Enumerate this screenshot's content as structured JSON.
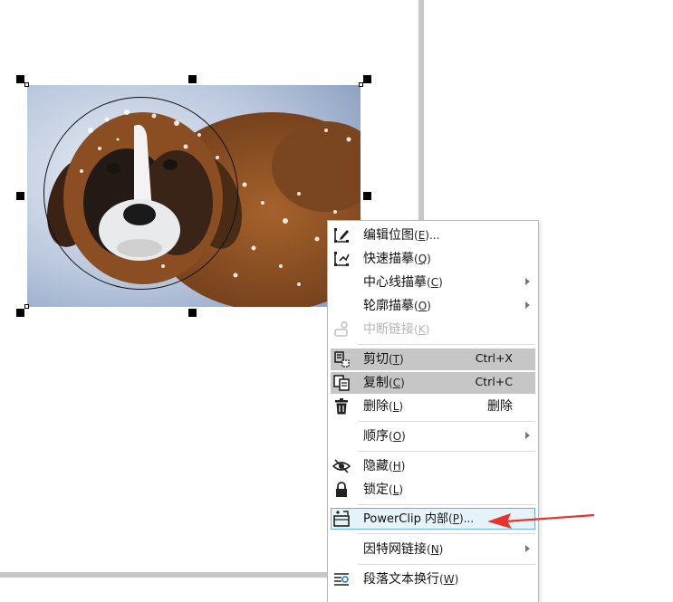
{
  "canvas": {
    "photo_subject": "saint-bernard-dog-in-snow"
  },
  "context_menu": {
    "items": [
      {
        "label": "编辑位图",
        "mnemonic": "E",
        "suffix": "...",
        "icon": "edit-bitmap-icon",
        "submenu": false,
        "shortcut": ""
      },
      {
        "label": "快速描摹",
        "mnemonic": "Q",
        "suffix": "",
        "icon": "quick-trace-icon",
        "submenu": false,
        "shortcut": ""
      },
      {
        "label": "中心线描摹",
        "mnemonic": "C",
        "suffix": "",
        "icon": "",
        "submenu": true,
        "shortcut": ""
      },
      {
        "label": "轮廓描摹",
        "mnemonic": "O",
        "suffix": "",
        "icon": "",
        "submenu": true,
        "shortcut": ""
      },
      {
        "label": "中断链接",
        "mnemonic": "K",
        "suffix": "",
        "icon": "break-link-icon",
        "submenu": false,
        "shortcut": "",
        "disabled": true
      },
      {
        "label": "剪切",
        "mnemonic": "T",
        "suffix": "",
        "icon": "cut-icon",
        "submenu": false,
        "shortcut": "Ctrl+X"
      },
      {
        "label": "复制",
        "mnemonic": "C",
        "suffix": "",
        "icon": "copy-icon",
        "submenu": false,
        "shortcut": "Ctrl+C"
      },
      {
        "label": "删除",
        "mnemonic": "L",
        "suffix": "",
        "icon": "trash-icon",
        "submenu": false,
        "shortcut": "删除"
      },
      {
        "label": "顺序",
        "mnemonic": "O",
        "suffix": "",
        "icon": "",
        "submenu": true,
        "shortcut": ""
      },
      {
        "label": "隐藏",
        "mnemonic": "H",
        "suffix": "",
        "icon": "eye-hidden-icon",
        "submenu": false,
        "shortcut": ""
      },
      {
        "label": "锁定",
        "mnemonic": "L",
        "suffix": "",
        "icon": "lock-icon",
        "submenu": false,
        "shortcut": ""
      },
      {
        "label": "PowerClip 内部",
        "mnemonic": "P",
        "suffix": "...",
        "icon": "powerclip-icon",
        "submenu": false,
        "shortcut": ""
      },
      {
        "label": "因特网链接",
        "mnemonic": "N",
        "suffix": "",
        "icon": "",
        "submenu": true,
        "shortcut": ""
      },
      {
        "label": "段落文本换行",
        "mnemonic": "W",
        "suffix": "",
        "icon": "text-wrap-icon",
        "submenu": false,
        "shortcut": ""
      }
    ]
  },
  "colors": {
    "menu_highlight": "#c6c6c6",
    "hover_border": "#69b4de",
    "hover_fill": "#e5f3fb",
    "annotation_arrow": "#e8322a"
  }
}
